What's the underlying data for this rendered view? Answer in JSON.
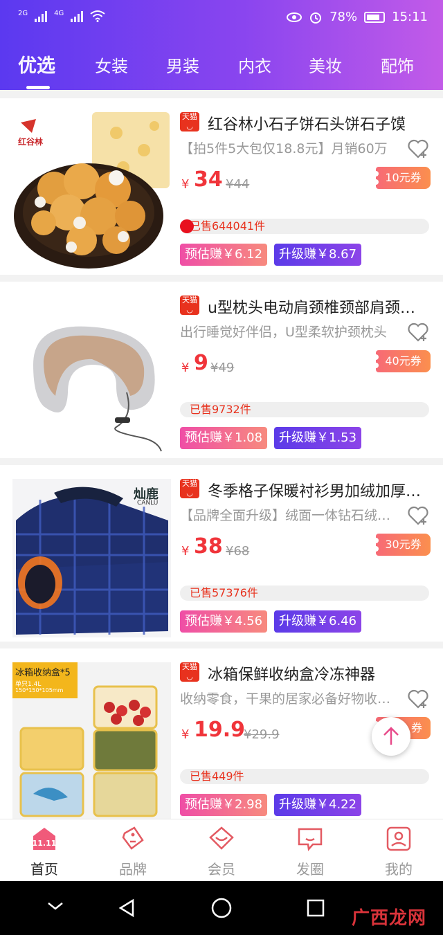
{
  "status_bar": {
    "net1": "2G",
    "net2": "4G",
    "battery": "78%",
    "time": "15:11"
  },
  "tabs": [
    {
      "label": "优选",
      "active": true
    },
    {
      "label": "女装"
    },
    {
      "label": "男装"
    },
    {
      "label": "内衣"
    },
    {
      "label": "美妆"
    },
    {
      "label": "配饰"
    }
  ],
  "products": [
    {
      "tmall": "天猫",
      "title": "红谷林小石子饼石头饼石子馍",
      "subtitle": "【拍5件5大包仅18.8元】月销60万",
      "price_symbol": "¥",
      "price": "34",
      "original": "¥44",
      "coupon": "10元券",
      "sold": "已售644041件",
      "estimate": "预估赚￥6.12",
      "upgrade": "升级赚￥8.67",
      "brand_text": "红谷林",
      "image": "cookies-photo"
    },
    {
      "tmall": "天猫",
      "title": "u型枕头电动肩颈椎颈部肩颈护颈仪",
      "subtitle": "出行睡觉好伴侣，U型柔软护颈枕头",
      "price_symbol": "¥",
      "price": "9",
      "original": "¥49",
      "coupon": "40元券",
      "sold": "已售9732件",
      "estimate": "预估赚￥1.08",
      "upgrade": "升级赚￥1.53",
      "image": "neck-pillow-photo"
    },
    {
      "tmall": "天猫",
      "title": "冬季格子保暖衬衫男加绒加厚衬衣",
      "subtitle": "【品牌全面升级】绒面一体钻石绒保暖",
      "price_symbol": "¥",
      "price": "38",
      "original": "¥68",
      "coupon": "30元券",
      "sold": "已售57376件",
      "estimate": "预估赚￥4.56",
      "upgrade": "升级赚￥6.46",
      "brand_text": "灿鹿",
      "brand_sub": "CANLU",
      "image": "plaid-shirt-photo"
    },
    {
      "tmall": "天猫",
      "title": "冰箱保鲜收纳盒冷冻神器",
      "subtitle": "收纳零食，干果的居家必备好物收纳盒",
      "price_symbol": "¥",
      "price": "19.9",
      "original": "¥29.9",
      "coupon": "券",
      "sold": "已售449件",
      "estimate": "预估赚￥2.98",
      "upgrade": "升级赚￥4.22",
      "brand_text": "冰箱收纳盒*5",
      "brand_sub": "单只1.4L",
      "brand_sub2": "150*150*105mm",
      "image": "storage-box-photo"
    }
  ],
  "bottom_nav": [
    {
      "label": "首页",
      "icon": "home-icon",
      "badge": "11.11",
      "active": true
    },
    {
      "label": "品牌",
      "icon": "tag-icon"
    },
    {
      "label": "会员",
      "icon": "member-icon"
    },
    {
      "label": "发圈",
      "icon": "chat-icon"
    },
    {
      "label": "我的",
      "icon": "profile-icon"
    }
  ],
  "watermark": "广西龙网",
  "colors": {
    "accent": "#f0343a",
    "header_start": "#5b39f0",
    "header_end": "#c25be8"
  }
}
